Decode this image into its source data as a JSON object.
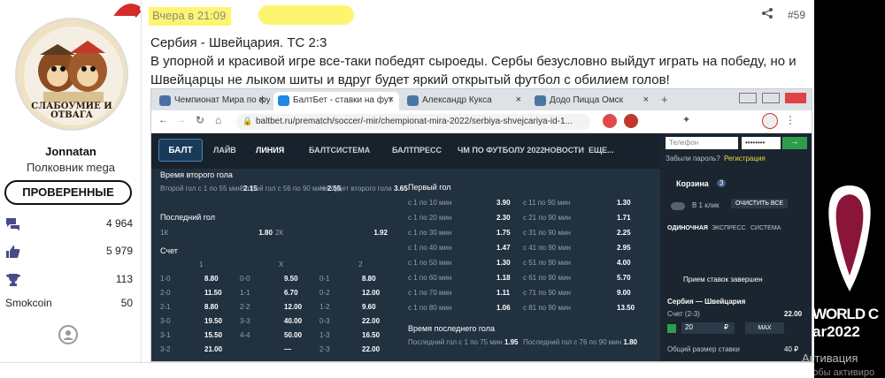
{
  "user": {
    "username": "Jonnatan",
    "rank": "Полковник mega",
    "badge": "ПРОВЕРЕННЫЕ",
    "avatar_caption": "СЛАБОУМИЕ И ОТВАГА",
    "stats": [
      {
        "icon": "messages-icon",
        "value": "4 964"
      },
      {
        "icon": "thumbs-up-icon",
        "value": "5 979"
      },
      {
        "icon": "trophy-icon",
        "value": "113"
      },
      {
        "label": "Smokcoin",
        "value": "50"
      }
    ]
  },
  "post": {
    "date": "Вчера в 21:09",
    "number": "#59",
    "title": "Сербия - Швейцария. ТС 2:3",
    "body": "В упорной и красивой игре все-таки победят сыроеды. Сербы безусловно выйдут играть на победу, но и Швейцарцы не лыком шиты и вдруг будет яркий открытый футбол с обилием голов!"
  },
  "browser": {
    "tabs": [
      {
        "label": "Чемпионат Мира по фу",
        "color": "#4a6fa5"
      },
      {
        "label": "БалтБет - ставки на фут",
        "color": "#1e88e5",
        "active": true
      },
      {
        "label": "Александр Кукса",
        "color": "#4c75a3"
      },
      {
        "label": "Додо Пицца Омск",
        "color": "#4c75a3"
      }
    ],
    "url": "baltbet.ru/prematch/soccer/-mir/chempionat-mira-2022/serbiya-shvejcariya-id-1..."
  },
  "site": {
    "nav": [
      "ЛАЙВ",
      "ЛИНИЯ",
      "БАЛТСИСТЕМА",
      "БАЛТПРЕСС",
      "ЧМ ПО ФУТБОЛУ 2022",
      "НОВОСТИ",
      "ЕЩЕ..."
    ],
    "login": {
      "phone_placeholder": "Телефон",
      "password": "••••••••",
      "forgot": "Забыли пароль?",
      "register": "Регистрация"
    },
    "sections": {
      "second_half_goal": {
        "title": "Время второго гола",
        "items": [
          {
            "label": "Второй гол с 1 по 55 мин",
            "odd": "2.15"
          },
          {
            "label": "Второй гол с 56 по 90 мин",
            "odd": "2.65"
          },
          {
            "label": "Не будет второго гола",
            "odd": "3.65"
          }
        ]
      },
      "last_goal": {
        "title": "Последний гол",
        "items": [
          {
            "label": "1К",
            "odd": "1.80"
          },
          {
            "label": "2К",
            "odd": "1.92"
          }
        ]
      },
      "score": {
        "title": "Счет",
        "headers": [
          "1",
          "X",
          "2"
        ],
        "rows": [
          [
            "1-0",
            "8.80",
            "0-0",
            "9.50",
            "0-1",
            "8.80"
          ],
          [
            "2-0",
            "11.50",
            "1-1",
            "6.70",
            "0-2",
            "12.00"
          ],
          [
            "2-1",
            "8.80",
            "2-2",
            "12.00",
            "1-2",
            "9.60"
          ],
          [
            "3-0",
            "19.50",
            "3-3",
            "40.00",
            "0-3",
            "22.00"
          ],
          [
            "3-1",
            "15.50",
            "4-4",
            "50.00",
            "1-3",
            "16.50"
          ],
          [
            "3-2",
            "21.00",
            "",
            "—",
            "2-3",
            "22.00"
          ]
        ]
      },
      "first_goal": {
        "title": "Первый гол",
        "rows": [
          [
            "с 1 по 10 мин",
            "3.90",
            "с 11 по 90 мин",
            "1.30"
          ],
          [
            "с 1 по 20 мин",
            "2.30",
            "с 21 по 90 мин",
            "1.71"
          ],
          [
            "с 1 по 30 мин",
            "1.75",
            "с 31 по 90 мин",
            "2.25"
          ],
          [
            "с 1 по 40 мин",
            "1.47",
            "с 41 по 90 мин",
            "2.95"
          ],
          [
            "с 1 по 50 мин",
            "1.30",
            "с 51 по 90 мин",
            "4.00"
          ],
          [
            "с 1 по 60 мин",
            "1.18",
            "с 61 по 90 мин",
            "5.70"
          ],
          [
            "с 1 по 70 мин",
            "1.11",
            "с 71 по 90 мин",
            "9.00"
          ],
          [
            "с 1 по 80 мин",
            "1.06",
            "с 81 по 90 мин",
            "13.50"
          ]
        ]
      },
      "last_goal_time": {
        "title": "Время последнего гола",
        "items": [
          {
            "label": "Последний гол с 1 по 75 мин",
            "odd": "1.95"
          },
          {
            "label": "Последний гол с 76 по 90 мин",
            "odd": "1.80"
          }
        ]
      }
    },
    "betslip": {
      "title": "Корзина",
      "count": "3",
      "one_click": "В 1 клик",
      "clear": "ОЧИСТИТЬ ВСЕ",
      "tabs": [
        "ОДИНОЧНАЯ",
        "ЭКСПРЕСС",
        "СИСТЕМА"
      ],
      "closed_text": "Прием ставок завершен",
      "match": "Сербия — Швейцария",
      "market": "Счет (2-3)",
      "odd": "22.00",
      "amount": "20",
      "currency": "₽",
      "max": "MAX",
      "total_label": "Общий размер ставки",
      "total_value": "40 ₽"
    }
  },
  "decor": {
    "wc_line1": "WORLD C",
    "wc_line2": "ar2022",
    "activation": "Активация",
    "activation_sub": "Чтобы активиро"
  }
}
